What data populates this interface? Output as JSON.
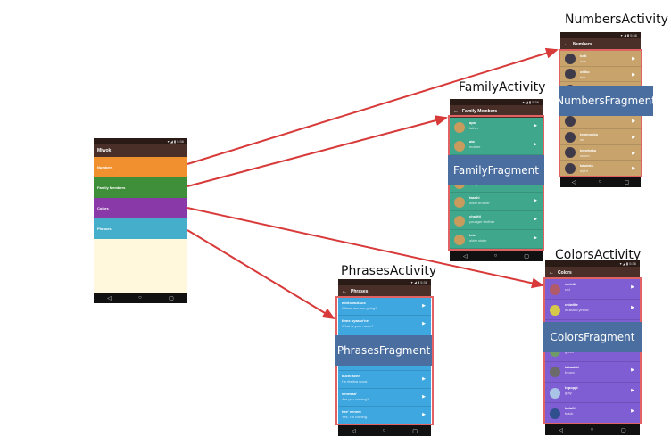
{
  "activities": {
    "numbers": {
      "title": "NumbersActivity",
      "fragment": "NumbersFragment",
      "appbar": "Numbers",
      "rows": [
        {
          "w1": "lutti",
          "w2": "one"
        },
        {
          "w1": "otiiko",
          "w2": "two"
        },
        {
          "w1": "",
          "w2": ""
        },
        {
          "w1": "",
          "w2": ""
        },
        {
          "w1": "",
          "w2": ""
        },
        {
          "w1": "temmokka",
          "w2": "six"
        },
        {
          "w1": "kenekaku",
          "w2": "seven"
        },
        {
          "w1": "kawinta",
          "w2": "eight"
        }
      ]
    },
    "family": {
      "title": "FamilyActivity",
      "fragment": "FamilyFragment",
      "appbar": "Family Members",
      "rows": [
        {
          "w1": "apa",
          "w2": "father"
        },
        {
          "w1": "ata",
          "w2": "mother"
        },
        {
          "w1": "",
          "w2": ""
        },
        {
          "w1": "",
          "w2": "daughter"
        },
        {
          "w1": "taachi",
          "w2": "older brother"
        },
        {
          "w1": "chalitti",
          "w2": "younger brother"
        },
        {
          "w1": "tete",
          "w2": "older sister"
        }
      ]
    },
    "colors": {
      "title": "ColorsActivity",
      "fragment": "ColorsFragment",
      "appbar": "Colors",
      "rows": [
        {
          "w1": "weteiti",
          "w2": "red"
        },
        {
          "w1": "chiwiite",
          "w2": "mustard yellow"
        },
        {
          "w1": "",
          "w2": ""
        },
        {
          "w1": "",
          "w2": "green"
        },
        {
          "w1": "takaakki",
          "w2": "brown"
        },
        {
          "w1": "topoppi",
          "w2": "gray"
        },
        {
          "w1": "kululli",
          "w2": "black"
        }
      ]
    },
    "phrases": {
      "title": "PhrasesActivity",
      "fragment": "PhrasesFragment",
      "appbar": "Phrases",
      "rows": [
        {
          "w1": "minto wuksus",
          "w2": "Where are you going?"
        },
        {
          "w1": "tinne oyaase'ne",
          "w2": "What is your name?"
        },
        {
          "w1": "",
          "w2": ""
        },
        {
          "w1": "",
          "w2": ""
        },
        {
          "w1": "kuchi achit",
          "w2": "I'm feeling good."
        },
        {
          "w1": "eenesaa'",
          "w2": "Are you coming?"
        },
        {
          "w1": "hee' eenem",
          "w2": "Yes, I'm coming."
        }
      ]
    }
  },
  "main": {
    "appbar": "Miwok",
    "categories": [
      {
        "label": "Numbers",
        "color": "#f0902e"
      },
      {
        "label": "Family Members",
        "color": "#3f8f3a"
      },
      {
        "label": "Colors",
        "color": "#8a3aa8"
      },
      {
        "label": "Phrases",
        "color": "#44aecb"
      }
    ],
    "background": "#fff8dc"
  },
  "colors": {
    "numbers_bg": "#c8a46c",
    "family_bg": "#3fa88c",
    "colors_bg": "#7f5ed3",
    "phrases_bg": "#3ea7e0",
    "arrow": "#d83a3a",
    "fragment_bar": "#4a6ea0",
    "frame": "#e06262"
  },
  "status_bar_text": "▾ ◢ ▮ 5:36",
  "nav_icons": [
    "back-icon",
    "home-icon",
    "recents-icon"
  ]
}
